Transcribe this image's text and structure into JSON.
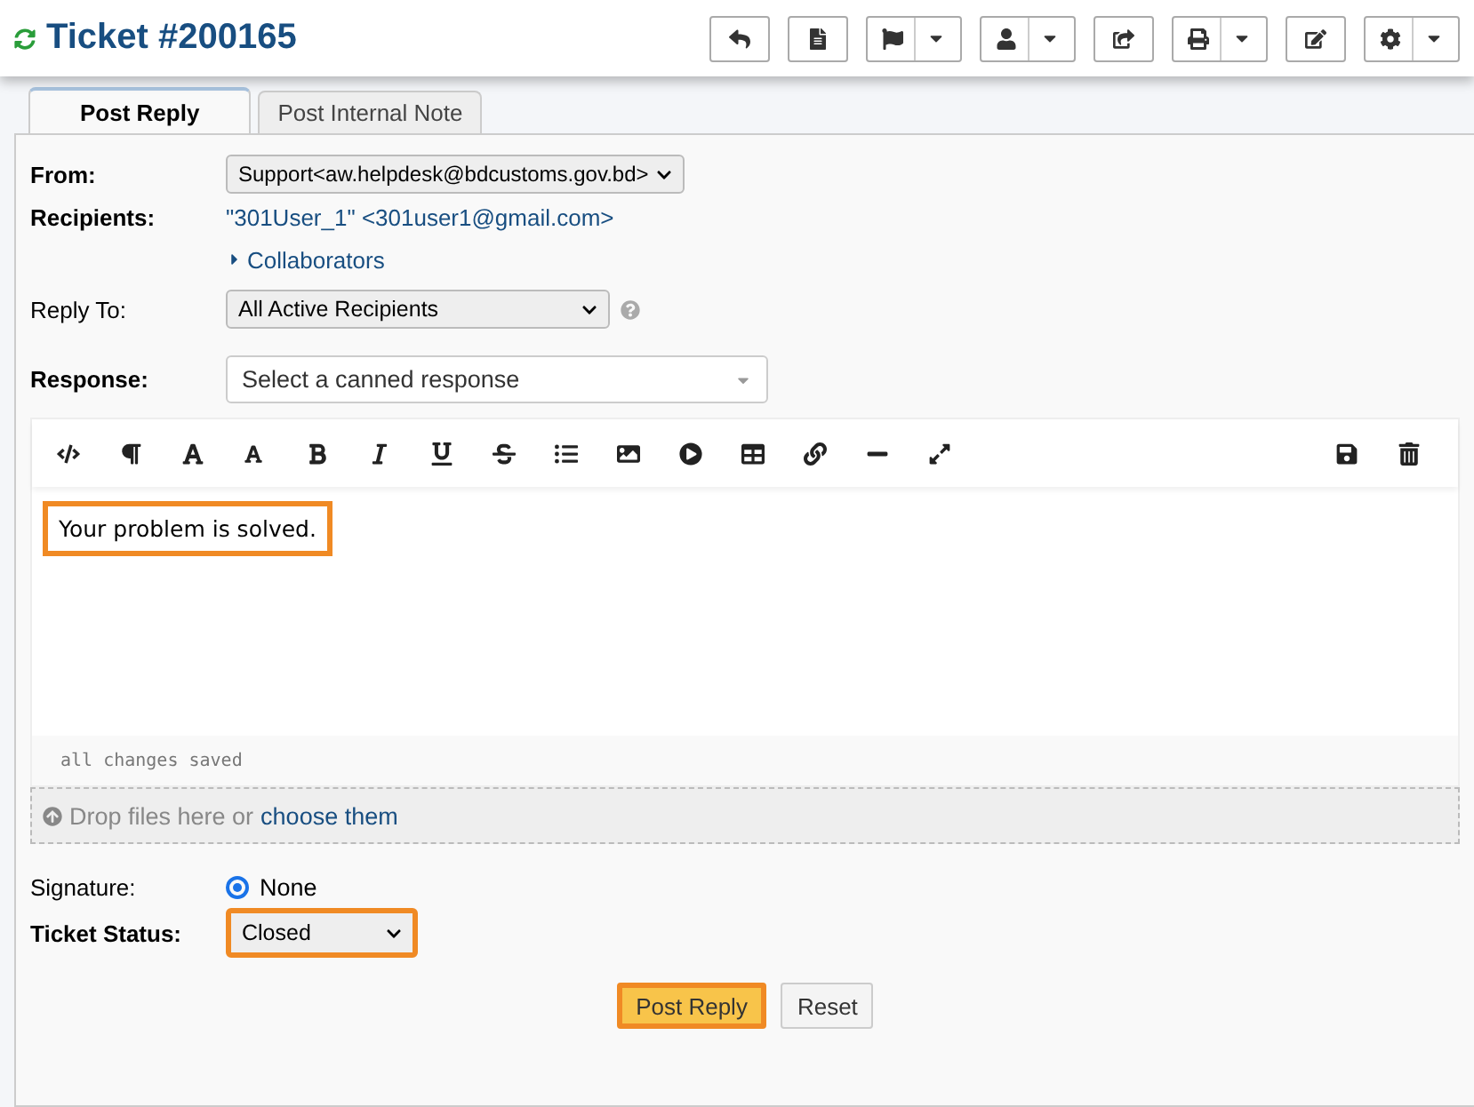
{
  "header": {
    "title": "Ticket #200165",
    "buttons": [
      {
        "dropdown": false
      },
      {
        "dropdown": false
      },
      {
        "dropdown": true
      },
      {
        "dropdown": true
      },
      {
        "dropdown": false
      },
      {
        "dropdown": true
      },
      {
        "dropdown": false
      },
      {
        "dropdown": true
      }
    ]
  },
  "tabs": [
    {
      "label": "Post Reply",
      "selected": true
    },
    {
      "label": "Post Internal Note",
      "selected": false
    }
  ],
  "form": {
    "from": {
      "label": "From:",
      "value": "Support<aw.helpdesk@bdcustoms.gov.bd>"
    },
    "recipients": {
      "label": "Recipients:",
      "value": "\"301User_1\" <301user1@gmail.com>",
      "collaborators": "Collaborators",
      "expanded": false
    },
    "reply_to": {
      "label": "Reply To:",
      "value": "All Active Recipients"
    },
    "response": {
      "label": "Response:",
      "placeholder": "Select a canned response"
    }
  },
  "editor": {
    "text": "Your problem is solved.",
    "highlighted": true,
    "status": "all changes saved"
  },
  "dropzone": {
    "text": "Drop files here or",
    "link": "choose them"
  },
  "signature": {
    "label": "Signature:",
    "option": "None",
    "selected": true
  },
  "ticket_status": {
    "label": "Ticket Status:",
    "value": "Closed",
    "highlighted": true
  },
  "actions": [
    {
      "label": "Post Reply",
      "kind": "primary",
      "highlighted": true
    },
    {
      "label": "Reset",
      "kind": "secondary",
      "highlighted": false
    }
  ]
}
